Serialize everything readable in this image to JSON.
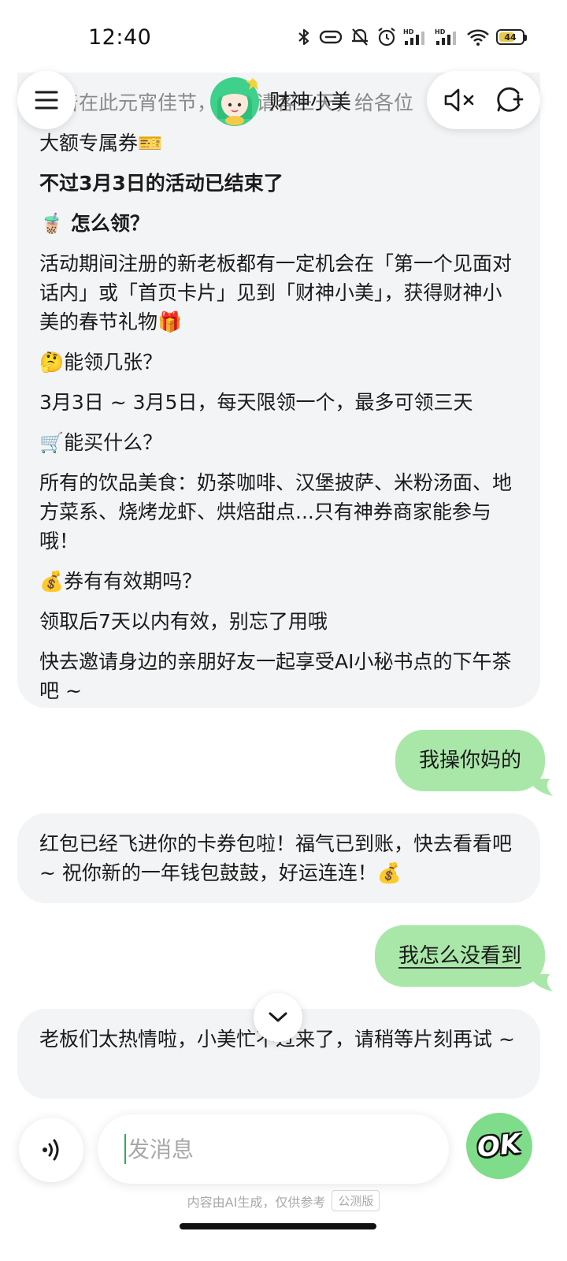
{
  "status_bar": {
    "time": "12:40",
    "battery": "44",
    "icons": [
      "bluetooth-icon",
      "vibrate-icon",
      "mute-bell-icon",
      "alarm-icon",
      "hd-signal-icon",
      "hd-signal-icon",
      "wifi-icon",
      "battery-icon"
    ]
  },
  "header": {
    "title": "财神小美",
    "menu_icon": "hamburger-menu-icon",
    "mute_icon": "speaker-mute-icon",
    "new_chat_icon": "new-chat-icon"
  },
  "messages": {
    "bot1": {
      "lines": [
        "趁着在此元宵佳节，连续请客三天，给各位",
        "大额专属券🎫",
        "不过3月3日的活动已结束了",
        "🧋 怎么领？",
        "活动期间注册的新老板都有一定机会在「第一个见面对话内」或「首页卡片」见到「财神小美」，获得财神小美的春节礼物🎁",
        "🤔能领几张？",
        "3月3日 ~ 3月5日，每天限领一个，最多可领三天",
        "🛒能买什么？",
        "所有的饮品美食：奶茶咖啡、汉堡披萨、米粉汤面、地方菜系、烧烤龙虾、烘焙甜点...只有神券商家能参与哦！",
        "💰券有有效期吗？",
        "领取后7天以内有效，别忘了用哦",
        "快去邀请身边的亲朋好友一起享受AI小秘书点的下午茶吧 ~"
      ]
    },
    "user1": "我操你妈的",
    "bot2": "红包已经飞进你的卡券包啦！福气已到账，快去看看吧 ~ 祝你新的一年钱包鼓鼓，好运连连！💰",
    "user2": "我怎么没看到",
    "bot3": "老板们太热情啦，小美忙不过来了，请稍等片刻再试 ~"
  },
  "input": {
    "placeholder": "发消息",
    "send_label": "OK"
  },
  "footer": {
    "disclaimer": "内容由AI生成，仅供参考",
    "badge": "公测版"
  },
  "colors": {
    "user_bubble": "#a9e7a9",
    "bot_bubble": "#f3f4f6",
    "accent": "#7fdc8a"
  }
}
